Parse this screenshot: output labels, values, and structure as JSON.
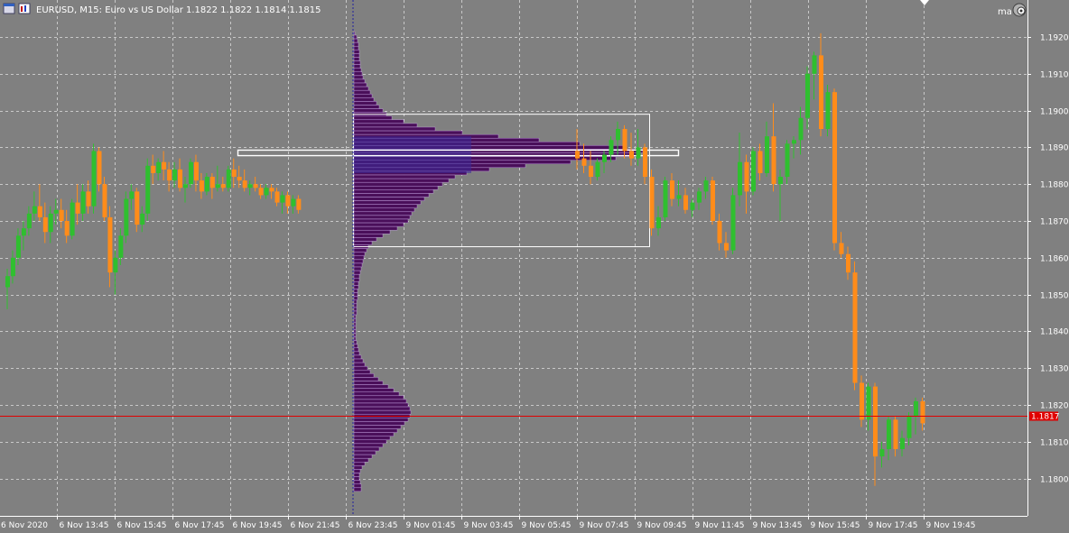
{
  "header": {
    "title": "EURUSD, M15:  Euro vs US Dollar  1.1822 1.1822 1.1814 1.1815",
    "right_label": "ma"
  },
  "icons": {
    "menu": "window-menu-icon",
    "chart_type": "chart-type-icon",
    "expert": "expert-advisor-icon",
    "shift": "chart-shift-marker-icon"
  },
  "colors": {
    "background": "#808080",
    "grid": "#c8c8c8",
    "bull": "#2fbf2f",
    "bear": "#ff8c1a",
    "doji": "#000000",
    "bid_line": "#e00000",
    "profile_fill": "#4a0f5a",
    "profile_edge": "#c8a6e6",
    "profile_value": "#3b2a9a",
    "value_area_box": "#ffffff"
  },
  "chart_data": {
    "type": "candlestick",
    "symbol": "EURUSD",
    "timeframe": "M15",
    "ylim": [
      1.1793,
      1.1934
    ],
    "y_ticks": [
      "1.1920",
      "1.1910",
      "1.1900",
      "1.1890",
      "1.1880",
      "1.1870",
      "1.1860",
      "1.1850",
      "1.1840",
      "1.1830",
      "1.1820",
      "1.1810",
      "1.1800"
    ],
    "x_labels": [
      "6 Nov 2020",
      "6 Nov 13:45",
      "6 Nov 15:45",
      "6 Nov 17:45",
      "6 Nov 19:45",
      "6 Nov 21:45",
      "6 Nov 23:45",
      "9 Nov 01:45",
      "9 Nov 03:45",
      "9 Nov 05:45",
      "9 Nov 07:45",
      "9 Nov 09:45",
      "9 Nov 11:45",
      "9 Nov 13:45",
      "9 Nov 15:45",
      "9 Nov 17:45",
      "9 Nov 19:45"
    ],
    "bid_price": 1.1817,
    "bid_label": "1.1817",
    "session_separator_label": "6 Nov 23:45",
    "candles_segment1": [
      [
        1.1852,
        1.1857,
        1.1846,
        1.1855
      ],
      [
        1.1855,
        1.1862,
        1.1853,
        1.186
      ],
      [
        1.186,
        1.1868,
        1.1858,
        1.1866
      ],
      [
        1.1866,
        1.187,
        1.1862,
        1.1868
      ],
      [
        1.1868,
        1.1874,
        1.1866,
        1.1872
      ],
      [
        1.1872,
        1.1878,
        1.187,
        1.1874
      ],
      [
        1.1874,
        1.188,
        1.187,
        1.1871
      ],
      [
        1.1871,
        1.1875,
        1.1864,
        1.1867
      ],
      [
        1.1867,
        1.1874,
        1.1864,
        1.1872
      ],
      [
        1.1872,
        1.1876,
        1.1869,
        1.1873
      ],
      [
        1.1873,
        1.1876,
        1.1868,
        1.187
      ],
      [
        1.187,
        1.1873,
        1.1864,
        1.1866
      ],
      [
        1.1866,
        1.1876,
        1.1865,
        1.1875
      ],
      [
        1.1875,
        1.188,
        1.1869,
        1.1872
      ],
      [
        1.1872,
        1.188,
        1.187,
        1.1878
      ],
      [
        1.1878,
        1.1881,
        1.1872,
        1.1874
      ],
      [
        1.1874,
        1.1891,
        1.1872,
        1.1889
      ],
      [
        1.1889,
        1.189,
        1.1878,
        1.188
      ],
      [
        1.188,
        1.1882,
        1.187,
        1.1871
      ],
      [
        1.1871,
        1.1874,
        1.1852,
        1.1856
      ],
      [
        1.1856,
        1.1862,
        1.185,
        1.186
      ],
      [
        1.186,
        1.1868,
        1.1858,
        1.1866
      ],
      [
        1.1866,
        1.1878,
        1.1864,
        1.1876
      ],
      [
        1.1876,
        1.188,
        1.1873,
        1.1878
      ],
      [
        1.1878,
        1.1879,
        1.1867,
        1.1869
      ],
      [
        1.1869,
        1.1874,
        1.1867,
        1.1872
      ],
      [
        1.1872,
        1.1887,
        1.187,
        1.1885
      ],
      [
        1.1885,
        1.1888,
        1.188,
        1.1883
      ],
      [
        1.1883,
        1.1887,
        1.1881,
        1.1886
      ],
      [
        1.1886,
        1.1889,
        1.1881,
        1.1884
      ],
      [
        1.1884,
        1.1886,
        1.1878,
        1.1881
      ],
      [
        1.1881,
        1.1886,
        1.1879,
        1.1884
      ],
      [
        1.1884,
        1.1887,
        1.1878,
        1.1879
      ],
      [
        1.1879,
        1.1882,
        1.1875,
        1.188
      ],
      [
        1.188,
        1.1887,
        1.1879,
        1.1886
      ],
      [
        1.1886,
        1.1888,
        1.1878,
        1.1881
      ],
      [
        1.1881,
        1.1883,
        1.1876,
        1.1878
      ],
      [
        1.1878,
        1.1883,
        1.1877,
        1.1882
      ],
      [
        1.1882,
        1.1883,
        1.1876,
        1.1879
      ],
      [
        1.1879,
        1.1885,
        1.1878,
        1.188
      ],
      [
        1.188,
        1.1882,
        1.1878,
        1.1879
      ],
      [
        1.1879,
        1.1885,
        1.1878,
        1.1884
      ],
      [
        1.1884,
        1.1887,
        1.1879,
        1.1882
      ],
      [
        1.1882,
        1.1885,
        1.1879,
        1.1881
      ],
      [
        1.1881,
        1.1884,
        1.1878,
        1.1879
      ],
      [
        1.1879,
        1.1881,
        1.1877,
        1.188
      ],
      [
        1.188,
        1.1882,
        1.1878,
        1.1879
      ],
      [
        1.1879,
        1.188,
        1.1876,
        1.1877
      ],
      [
        1.1877,
        1.188,
        1.1876,
        1.1879
      ],
      [
        1.1879,
        1.188,
        1.1876,
        1.1878
      ],
      [
        1.1878,
        1.1879,
        1.1874,
        1.1875
      ],
      [
        1.1875,
        1.1878,
        1.1872,
        1.1877
      ],
      [
        1.1877,
        1.1878,
        1.1872,
        1.1874
      ],
      [
        1.1874,
        1.1877,
        1.1872,
        1.1876
      ],
      [
        1.1876,
        1.1877,
        1.1872,
        1.1873
      ]
    ],
    "candles_segment2": [
      [
        1.1889,
        1.1895,
        1.1884,
        1.1887
      ],
      [
        1.1887,
        1.1891,
        1.1883,
        1.1885
      ],
      [
        1.1885,
        1.1889,
        1.188,
        1.1882
      ],
      [
        1.1882,
        1.1887,
        1.1881,
        1.1886
      ],
      [
        1.1886,
        1.1889,
        1.1883,
        1.1888
      ],
      [
        1.1888,
        1.1893,
        1.1886,
        1.1892
      ],
      [
        1.1892,
        1.1897,
        1.1888,
        1.1895
      ],
      [
        1.1895,
        1.1896,
        1.1887,
        1.1889
      ],
      [
        1.1889,
        1.1894,
        1.1885,
        1.1887
      ],
      [
        1.1887,
        1.1895,
        1.1885,
        1.189
      ],
      [
        1.189,
        1.1891,
        1.188,
        1.1882
      ],
      [
        1.1882,
        1.1884,
        1.1866,
        1.1868
      ],
      [
        1.1868,
        1.1874,
        1.1866,
        1.1871
      ],
      [
        1.1871,
        1.1882,
        1.187,
        1.1881
      ],
      [
        1.1881,
        1.1883,
        1.1874,
        1.1876
      ],
      [
        1.1876,
        1.1881,
        1.1874,
        1.1877
      ],
      [
        1.1877,
        1.1879,
        1.1872,
        1.1873
      ],
      [
        1.1873,
        1.1876,
        1.1871,
        1.1875
      ],
      [
        1.1875,
        1.1879,
        1.1873,
        1.1878
      ],
      [
        1.1878,
        1.1882,
        1.1876,
        1.1881
      ],
      [
        1.1881,
        1.1882,
        1.1869,
        1.187
      ],
      [
        1.187,
        1.1872,
        1.1862,
        1.1864
      ],
      [
        1.1864,
        1.1867,
        1.186,
        1.1862
      ],
      [
        1.1862,
        1.1879,
        1.1861,
        1.1877
      ],
      [
        1.1877,
        1.1894,
        1.1874,
        1.1886
      ],
      [
        1.1886,
        1.1888,
        1.1872,
        1.1878
      ],
      [
        1.1878,
        1.189,
        1.1877,
        1.1889
      ],
      [
        1.1889,
        1.1891,
        1.1881,
        1.1883
      ],
      [
        1.1883,
        1.1897,
        1.1882,
        1.1893
      ],
      [
        1.1893,
        1.1902,
        1.1878,
        1.188
      ],
      [
        1.188,
        1.1884,
        1.187,
        1.1882
      ],
      [
        1.1882,
        1.1892,
        1.188,
        1.1891
      ],
      [
        1.1891,
        1.1893,
        1.1887,
        1.1892
      ],
      [
        1.1892,
        1.1901,
        1.1888,
        1.1898
      ],
      [
        1.1898,
        1.1912,
        1.1895,
        1.191
      ],
      [
        1.191,
        1.1916,
        1.1903,
        1.1915
      ],
      [
        1.1915,
        1.1921,
        1.1893,
        1.1895
      ],
      [
        1.1895,
        1.1907,
        1.1893,
        1.1905
      ],
      [
        1.1905,
        1.1906,
        1.1862,
        1.1864
      ],
      [
        1.1864,
        1.1867,
        1.186,
        1.1861
      ],
      [
        1.1861,
        1.1863,
        1.1854,
        1.1856
      ],
      [
        1.1856,
        1.1859,
        1.1824,
        1.1826
      ],
      [
        1.1826,
        1.1828,
        1.1814,
        1.1816
      ],
      [
        1.1816,
        1.1826,
        1.1813,
        1.1825
      ],
      [
        1.1825,
        1.1826,
        1.1798,
        1.1806
      ],
      [
        1.1806,
        1.181,
        1.1803,
        1.1808
      ],
      [
        1.1808,
        1.1817,
        1.1805,
        1.1816
      ],
      [
        1.1816,
        1.1817,
        1.1806,
        1.1808
      ],
      [
        1.1808,
        1.1813,
        1.1806,
        1.1811
      ],
      [
        1.1811,
        1.1818,
        1.1809,
        1.1817
      ],
      [
        1.1817,
        1.1822,
        1.1812,
        1.1821
      ],
      [
        1.1821,
        1.1822,
        1.1813,
        1.1815
      ]
    ],
    "profile_upper": [
      [
        1.1921,
        1
      ],
      [
        1.192,
        3
      ],
      [
        1.1919,
        4
      ],
      [
        1.1918,
        5
      ],
      [
        1.1917,
        5
      ],
      [
        1.1916,
        6
      ],
      [
        1.1915,
        6
      ],
      [
        1.1914,
        6
      ],
      [
        1.1913,
        7
      ],
      [
        1.1912,
        7
      ],
      [
        1.1911,
        8
      ],
      [
        1.191,
        9
      ],
      [
        1.1909,
        10
      ],
      [
        1.1908,
        12
      ],
      [
        1.1907,
        14
      ],
      [
        1.1906,
        16
      ],
      [
        1.1905,
        18
      ],
      [
        1.1904,
        20
      ],
      [
        1.1903,
        22
      ],
      [
        1.1902,
        25
      ],
      [
        1.1901,
        28
      ],
      [
        1.19,
        32
      ],
      [
        1.1899,
        36
      ],
      [
        1.1898,
        42
      ],
      [
        1.1897,
        55
      ],
      [
        1.1896,
        70
      ],
      [
        1.1895,
        90
      ],
      [
        1.1894,
        120
      ],
      [
        1.1893,
        160
      ],
      [
        1.1892,
        205
      ],
      [
        1.1891,
        250
      ],
      [
        1.189,
        298
      ],
      [
        1.1889,
        320
      ],
      [
        1.1888,
        318
      ],
      [
        1.1887,
        290
      ],
      [
        1.1886,
        240
      ],
      [
        1.1885,
        190
      ],
      [
        1.1884,
        150
      ],
      [
        1.1883,
        125
      ],
      [
        1.1882,
        112
      ],
      [
        1.1881,
        105
      ],
      [
        1.188,
        98
      ],
      [
        1.1879,
        93
      ],
      [
        1.1878,
        88
      ],
      [
        1.1877,
        83
      ],
      [
        1.1876,
        78
      ],
      [
        1.1875,
        74
      ],
      [
        1.1874,
        70
      ],
      [
        1.1873,
        67
      ],
      [
        1.1872,
        64
      ],
      [
        1.1871,
        62
      ],
      [
        1.187,
        60
      ],
      [
        1.1869,
        55
      ],
      [
        1.1868,
        48
      ],
      [
        1.1867,
        40
      ],
      [
        1.1866,
        32
      ],
      [
        1.1865,
        25
      ],
      [
        1.1864,
        20
      ],
      [
        1.1863,
        16
      ],
      [
        1.1862,
        14
      ],
      [
        1.1861,
        12
      ],
      [
        1.186,
        11
      ],
      [
        1.1859,
        10
      ],
      [
        1.1858,
        9
      ],
      [
        1.1857,
        8
      ],
      [
        1.1856,
        7
      ],
      [
        1.1855,
        6
      ],
      [
        1.1854,
        6
      ],
      [
        1.1853,
        5
      ],
      [
        1.1852,
        5
      ],
      [
        1.1851,
        4
      ],
      [
        1.185,
        4
      ],
      [
        1.1849,
        4
      ],
      [
        1.1848,
        3
      ],
      [
        1.1847,
        3
      ],
      [
        1.1846,
        3
      ],
      [
        1.1845,
        3
      ],
      [
        1.1844,
        2
      ],
      [
        1.1843,
        2
      ],
      [
        1.1842,
        2
      ],
      [
        1.1841,
        2
      ],
      [
        1.184,
        2
      ],
      [
        1.1839,
        2
      ],
      [
        1.1838,
        2
      ],
      [
        1.1837,
        3
      ],
      [
        1.1836,
        4
      ],
      [
        1.1835,
        5
      ],
      [
        1.1834,
        6
      ],
      [
        1.1833,
        8
      ],
      [
        1.1832,
        10
      ],
      [
        1.1831,
        12
      ],
      [
        1.183,
        15
      ]
    ],
    "profile_lower": [
      [
        1.1829,
        18
      ],
      [
        1.1828,
        22
      ],
      [
        1.1827,
        27
      ],
      [
        1.1826,
        32
      ],
      [
        1.1825,
        38
      ],
      [
        1.1824,
        44
      ],
      [
        1.1823,
        50
      ],
      [
        1.1822,
        55
      ],
      [
        1.1821,
        58
      ],
      [
        1.182,
        60
      ],
      [
        1.1819,
        62
      ],
      [
        1.1818,
        63
      ],
      [
        1.1817,
        62
      ],
      [
        1.1816,
        60
      ],
      [
        1.1815,
        56
      ],
      [
        1.1814,
        52
      ],
      [
        1.1813,
        48
      ],
      [
        1.1812,
        44
      ],
      [
        1.1811,
        40
      ],
      [
        1.181,
        36
      ],
      [
        1.1809,
        32
      ],
      [
        1.1808,
        28
      ],
      [
        1.1807,
        24
      ],
      [
        1.1806,
        20
      ],
      [
        1.1805,
        16
      ],
      [
        1.1804,
        12
      ],
      [
        1.1803,
        9
      ],
      [
        1.1802,
        7
      ],
      [
        1.1801,
        6
      ],
      [
        1.18,
        6
      ],
      [
        1.1799,
        7
      ],
      [
        1.1798,
        8
      ],
      [
        1.1797,
        8
      ]
    ],
    "value_area_box": {
      "high": 1.1899,
      "low": 1.1863
    },
    "poc_box": {
      "high": 1.1889,
      "low": 1.1888
    }
  }
}
